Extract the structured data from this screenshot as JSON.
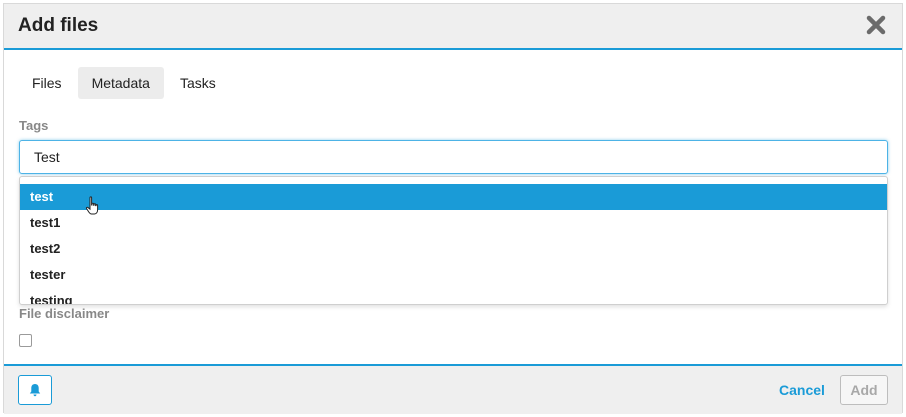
{
  "dialog": {
    "title": "Add files"
  },
  "tabs": [
    {
      "label": "Files",
      "active": false
    },
    {
      "label": "Metadata",
      "active": true
    },
    {
      "label": "Tasks",
      "active": false
    }
  ],
  "tags": {
    "label": "Tags",
    "value": "Test",
    "suggestions": [
      "test",
      "test1",
      "test2",
      "tester",
      "testing"
    ],
    "selected_index": 0
  },
  "disclaimer": {
    "label": "File disclaimer",
    "checked": false
  },
  "footer": {
    "cancel_label": "Cancel",
    "add_label": "Add",
    "bell_icon": "bell-icon"
  },
  "colors": {
    "accent": "#1a9bd7",
    "header_bg": "#efefef"
  }
}
